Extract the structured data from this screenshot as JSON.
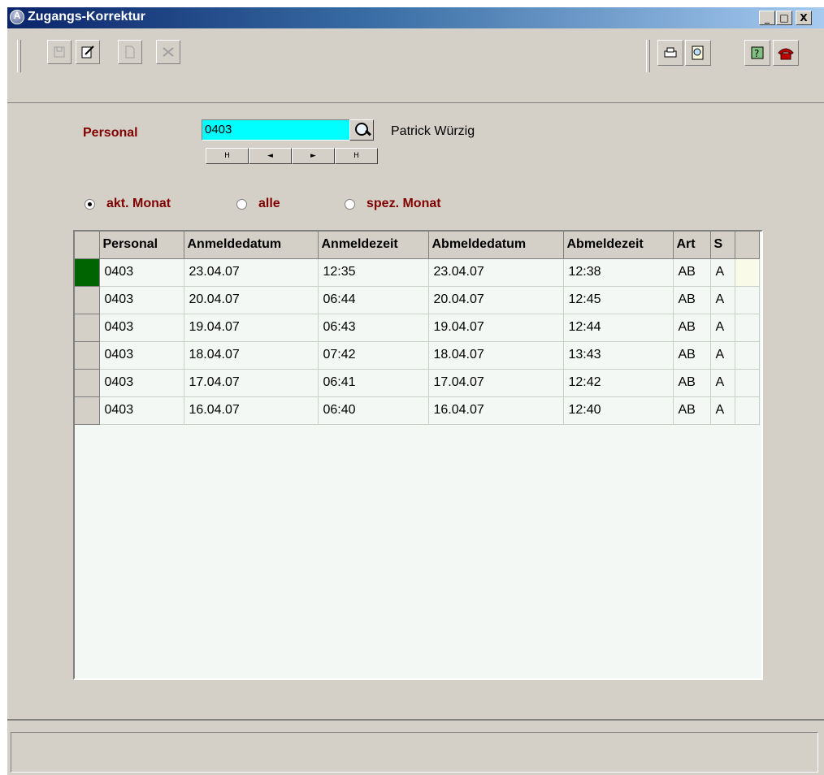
{
  "window": {
    "title": "Zugangs-Korrektur",
    "minimize": "_",
    "maximize": "□",
    "close": "X"
  },
  "form": {
    "personal_label": "Personal",
    "personal_value": "0403",
    "person_name": "Patrick Würzig",
    "nav": [
      "H",
      "◄",
      "►",
      "H"
    ]
  },
  "radios": [
    {
      "label": "akt. Monat",
      "selected": true
    },
    {
      "label": "alle",
      "selected": false
    },
    {
      "label": "spez. Monat",
      "selected": false
    }
  ],
  "table": {
    "columns": [
      "Personal",
      "Anmeldedatum",
      "Anmeldezeit",
      "Abmeldedatum",
      "Abmeldezeit",
      "Art",
      "S"
    ],
    "rows": [
      [
        "0403",
        "23.04.07",
        "12:35",
        "23.04.07",
        "12:38",
        "AB",
        "A"
      ],
      [
        "0403",
        "20.04.07",
        "06:44",
        "20.04.07",
        "12:45",
        "AB",
        "A"
      ],
      [
        "0403",
        "19.04.07",
        "06:43",
        "19.04.07",
        "12:44",
        "AB",
        "A"
      ],
      [
        "0403",
        "18.04.07",
        "07:42",
        "18.04.07",
        "13:43",
        "AB",
        "A"
      ],
      [
        "0403",
        "17.04.07",
        "06:41",
        "17.04.07",
        "12:42",
        "AB",
        "A"
      ],
      [
        "0403",
        "16.04.07",
        "06:40",
        "16.04.07",
        "12:40",
        "AB",
        "A"
      ]
    ],
    "selected_row": 0
  },
  "colors": {
    "input_bg": "#00ffff",
    "label_red": "#800000",
    "selected_indicator": "#006400"
  }
}
